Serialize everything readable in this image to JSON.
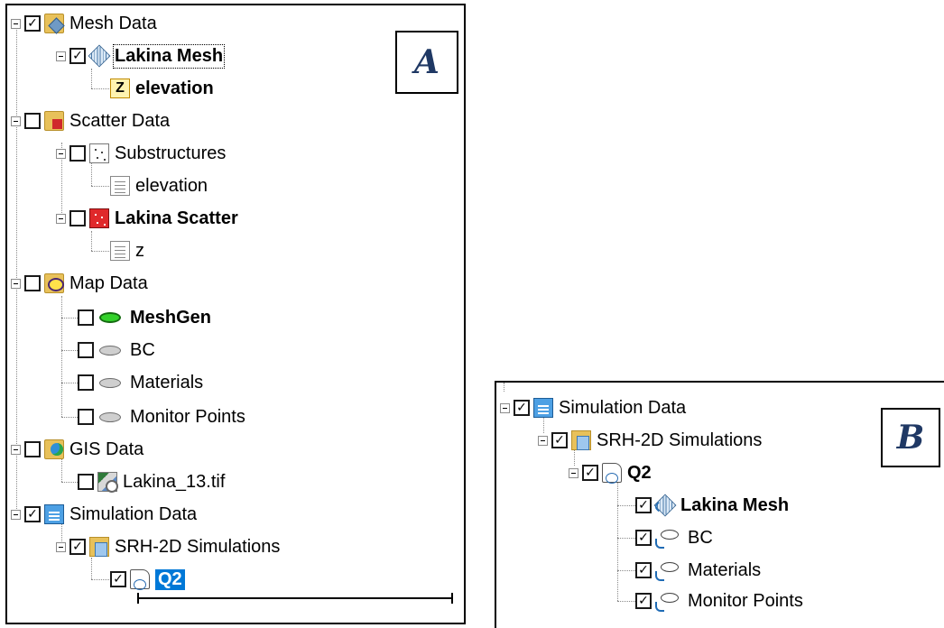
{
  "panel_a": {
    "label": "A",
    "tree": {
      "mesh_data": {
        "label": "Mesh Data",
        "checked": "✓"
      },
      "lakina_mesh": {
        "label": "Lakina Mesh",
        "checked": "✓"
      },
      "mesh_elevation": {
        "label": "elevation",
        "icon_text": "Z"
      },
      "scatter_data": {
        "label": "Scatter Data",
        "checked": ""
      },
      "substructures": {
        "label": "Substructures",
        "checked": ""
      },
      "sub_elevation": {
        "label": "elevation"
      },
      "lakina_scatter": {
        "label": "Lakina Scatter",
        "checked": ""
      },
      "scatter_z": {
        "label": "z"
      },
      "map_data": {
        "label": "Map Data",
        "checked": ""
      },
      "meshgen": {
        "label": "MeshGen",
        "checked": ""
      },
      "bc": {
        "label": "BC",
        "checked": ""
      },
      "materials": {
        "label": "Materials",
        "checked": ""
      },
      "monitor_points": {
        "label": "Monitor Points",
        "checked": ""
      },
      "gis_data": {
        "label": "GIS Data",
        "checked": ""
      },
      "lakina_tif": {
        "label": "Lakina_13.tif",
        "checked": ""
      },
      "simulation_data": {
        "label": "Simulation Data",
        "checked": "✓"
      },
      "srh_sims": {
        "label": "SRH-2D Simulations",
        "checked": "✓"
      },
      "q2": {
        "label": "Q2",
        "checked": "✓"
      }
    }
  },
  "panel_b": {
    "label": "B",
    "tree": {
      "simulation_data": {
        "label": "Simulation Data",
        "checked": "✓"
      },
      "srh_sims": {
        "label": "SRH-2D Simulations",
        "checked": "✓"
      },
      "q2": {
        "label": "Q2",
        "checked": "✓"
      },
      "lakina_mesh": {
        "label": "Lakina Mesh",
        "checked": "✓"
      },
      "bc": {
        "label": "BC",
        "checked": "✓"
      },
      "materials": {
        "label": "Materials",
        "checked": "✓"
      },
      "monitor_points": {
        "label": "Monitor Points",
        "checked": "✓"
      }
    }
  },
  "colors": {
    "selection": "#0078d7",
    "label_text": "#1f3864",
    "active_coverage": "#33d12a"
  },
  "icons": [
    "mesh-folder-icon",
    "mesh-icon",
    "z-dataset-icon",
    "scatter-folder-icon",
    "scatter-icon",
    "dataset-list-icon",
    "map-folder-icon",
    "coverage-icon",
    "gis-folder-icon",
    "raster-icon",
    "simulation-folder-icon",
    "simulation-icon",
    "linked-item-icon"
  ]
}
